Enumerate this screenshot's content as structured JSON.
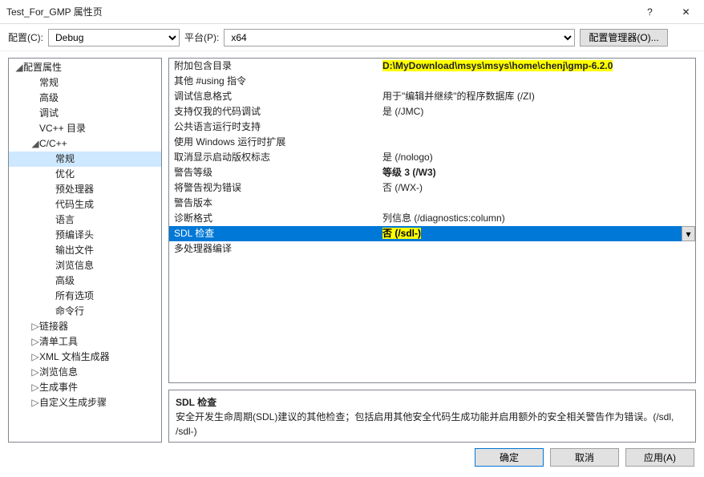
{
  "window": {
    "title": "Test_For_GMP 属性页"
  },
  "top": {
    "config_label": "配置(C):",
    "config_value": "Debug",
    "platform_label": "平台(P):",
    "platform_value": "x64",
    "manager_label": "配置管理器(O)..."
  },
  "tree": [
    {
      "label": "配置属性",
      "depth": 0,
      "arrow": "◢"
    },
    {
      "label": "常规",
      "depth": 1,
      "arrow": ""
    },
    {
      "label": "高级",
      "depth": 1,
      "arrow": ""
    },
    {
      "label": "调试",
      "depth": 1,
      "arrow": ""
    },
    {
      "label": "VC++ 目录",
      "depth": 1,
      "arrow": ""
    },
    {
      "label": "C/C++",
      "depth": 1,
      "arrow": "◢"
    },
    {
      "label": "常规",
      "depth": 2,
      "arrow": "",
      "selected": true
    },
    {
      "label": "优化",
      "depth": 2,
      "arrow": ""
    },
    {
      "label": "预处理器",
      "depth": 2,
      "arrow": ""
    },
    {
      "label": "代码生成",
      "depth": 2,
      "arrow": ""
    },
    {
      "label": "语言",
      "depth": 2,
      "arrow": ""
    },
    {
      "label": "预编译头",
      "depth": 2,
      "arrow": ""
    },
    {
      "label": "输出文件",
      "depth": 2,
      "arrow": ""
    },
    {
      "label": "浏览信息",
      "depth": 2,
      "arrow": ""
    },
    {
      "label": "高级",
      "depth": 2,
      "arrow": ""
    },
    {
      "label": "所有选项",
      "depth": 2,
      "arrow": ""
    },
    {
      "label": "命令行",
      "depth": 2,
      "arrow": ""
    },
    {
      "label": "链接器",
      "depth": 1,
      "arrow": "▷"
    },
    {
      "label": "清单工具",
      "depth": 1,
      "arrow": "▷"
    },
    {
      "label": "XML 文档生成器",
      "depth": 1,
      "arrow": "▷"
    },
    {
      "label": "浏览信息",
      "depth": 1,
      "arrow": "▷"
    },
    {
      "label": "生成事件",
      "depth": 1,
      "arrow": "▷"
    },
    {
      "label": "自定义生成步骤",
      "depth": 1,
      "arrow": "▷"
    }
  ],
  "grid": [
    {
      "k": "附加包含目录",
      "v": "D:\\MyDownload\\msys\\msys\\home\\chenj\\gmp-6.2.0",
      "hl": true,
      "bold": true
    },
    {
      "k": "其他 #using 指令",
      "v": ""
    },
    {
      "k": "调试信息格式",
      "v": "用于\"编辑并继续\"的程序数据库 (/ZI)"
    },
    {
      "k": "支持仅我的代码调试",
      "v": "是 (/JMC)"
    },
    {
      "k": "公共语言运行时支持",
      "v": ""
    },
    {
      "k": "使用 Windows 运行时扩展",
      "v": ""
    },
    {
      "k": "取消显示启动版权标志",
      "v": "是 (/nologo)"
    },
    {
      "k": "警告等级",
      "v": "等级 3 (/W3)",
      "bold": true
    },
    {
      "k": "将警告视为错误",
      "v": "否 (/WX-)"
    },
    {
      "k": "警告版本",
      "v": ""
    },
    {
      "k": "诊断格式",
      "v": "列信息 (/diagnostics:column)"
    },
    {
      "k": "SDL 检查",
      "v": "否 (/sdl-)",
      "selected": true,
      "hl": true,
      "bold": true
    },
    {
      "k": "多处理器编译",
      "v": ""
    }
  ],
  "desc": {
    "title": "SDL 检查",
    "body": "安全开发生命周期(SDL)建议的其他检查；包括启用其他安全代码生成功能并启用额外的安全相关警告作为错误。(/sdl, /sdl-)"
  },
  "footer": {
    "ok": "确定",
    "cancel": "取消",
    "apply": "应用(A)"
  }
}
